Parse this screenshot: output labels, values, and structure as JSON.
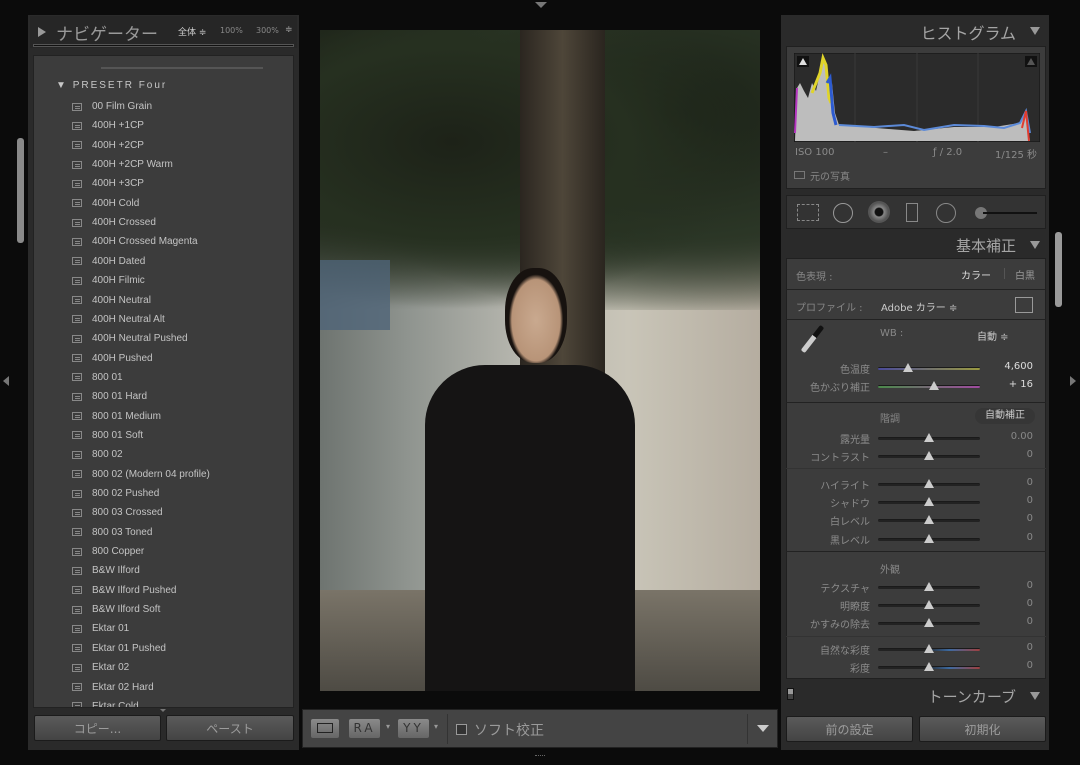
{
  "navigator": {
    "title": "ナビゲーター",
    "zoom_fit": "全体 ≑",
    "zoom_100": "100%",
    "zoom_300": "300%",
    "stepper": "≑"
  },
  "presets": {
    "group": "PRESETR Four",
    "items": [
      "00 Film Grain",
      "400H +1CP",
      "400H +2CP",
      "400H +2CP Warm",
      "400H +3CP",
      "400H Cold",
      "400H Crossed",
      "400H Crossed Magenta",
      "400H Dated",
      "400H Filmic",
      "400H Neutral",
      "400H Neutral Alt",
      "400H Neutral Pushed",
      "400H Pushed",
      "800 01",
      "800 01 Hard",
      "800 01 Medium",
      "800 01 Soft",
      "800 02",
      "800 02 (Modern 04 profile)",
      "800 02 Pushed",
      "800 03 Crossed",
      "800 03 Toned",
      "800 Copper",
      "B&W Ilford",
      "B&W Ilford Pushed",
      "B&W Ilford Soft",
      "Ektar 01",
      "Ektar 01 Pushed",
      "Ektar 02",
      "Ektar 02 Hard",
      "Ektar Cold"
    ]
  },
  "left_buttons": {
    "copy": "コピー...",
    "paste": "ペースト"
  },
  "toolbar": {
    "view_ra": "RA",
    "view_yy": "YY",
    "soft_proof_label": "ソフト校正",
    "soft_proof_checked": false
  },
  "histogram": {
    "title": "ヒストグラム",
    "iso": "ISO 100",
    "focal": "–",
    "aperture": "ƒ / 2.0",
    "shutter": "1/125 秒",
    "original_photo": "元の写真"
  },
  "basic": {
    "title": "基本補正",
    "treatment_label": "色表現 :",
    "color": "カラー",
    "bw": "白黒",
    "profile_label": "プロファイル :",
    "profile_value": "Adobe カラー ≑",
    "wb_label": "WB :",
    "wb_value": "自動 ≑",
    "tone_label": "階調",
    "auto_button": "自動補正",
    "presence_label": "外観",
    "sliders": [
      {
        "label": "色温度",
        "value": "4,600",
        "pos": 0.29
      },
      {
        "label": "色かぶり補正",
        "value": "+ 16",
        "pos": 0.55
      },
      {
        "label": "露光量",
        "value": "0.00",
        "pos": 0.5
      },
      {
        "label": "コントラスト",
        "value": "0",
        "pos": 0.5
      },
      {
        "label": "ハイライト",
        "value": "0",
        "pos": 0.5
      },
      {
        "label": "シャドウ",
        "value": "0",
        "pos": 0.5
      },
      {
        "label": "白レベル",
        "value": "0",
        "pos": 0.5
      },
      {
        "label": "黒レベル",
        "value": "0",
        "pos": 0.5
      },
      {
        "label": "テクスチャ",
        "value": "0",
        "pos": 0.5
      },
      {
        "label": "明瞭度",
        "value": "0",
        "pos": 0.5
      },
      {
        "label": "かすみの除去",
        "value": "0",
        "pos": 0.5
      },
      {
        "label": "自然な彩度",
        "value": "0",
        "pos": 0.5
      },
      {
        "label": "彩度",
        "value": "0",
        "pos": 0.5
      }
    ]
  },
  "tone_curve": {
    "title": "トーンカーブ"
  },
  "right_buttons": {
    "previous": "前の設定",
    "reset": "初期化"
  }
}
